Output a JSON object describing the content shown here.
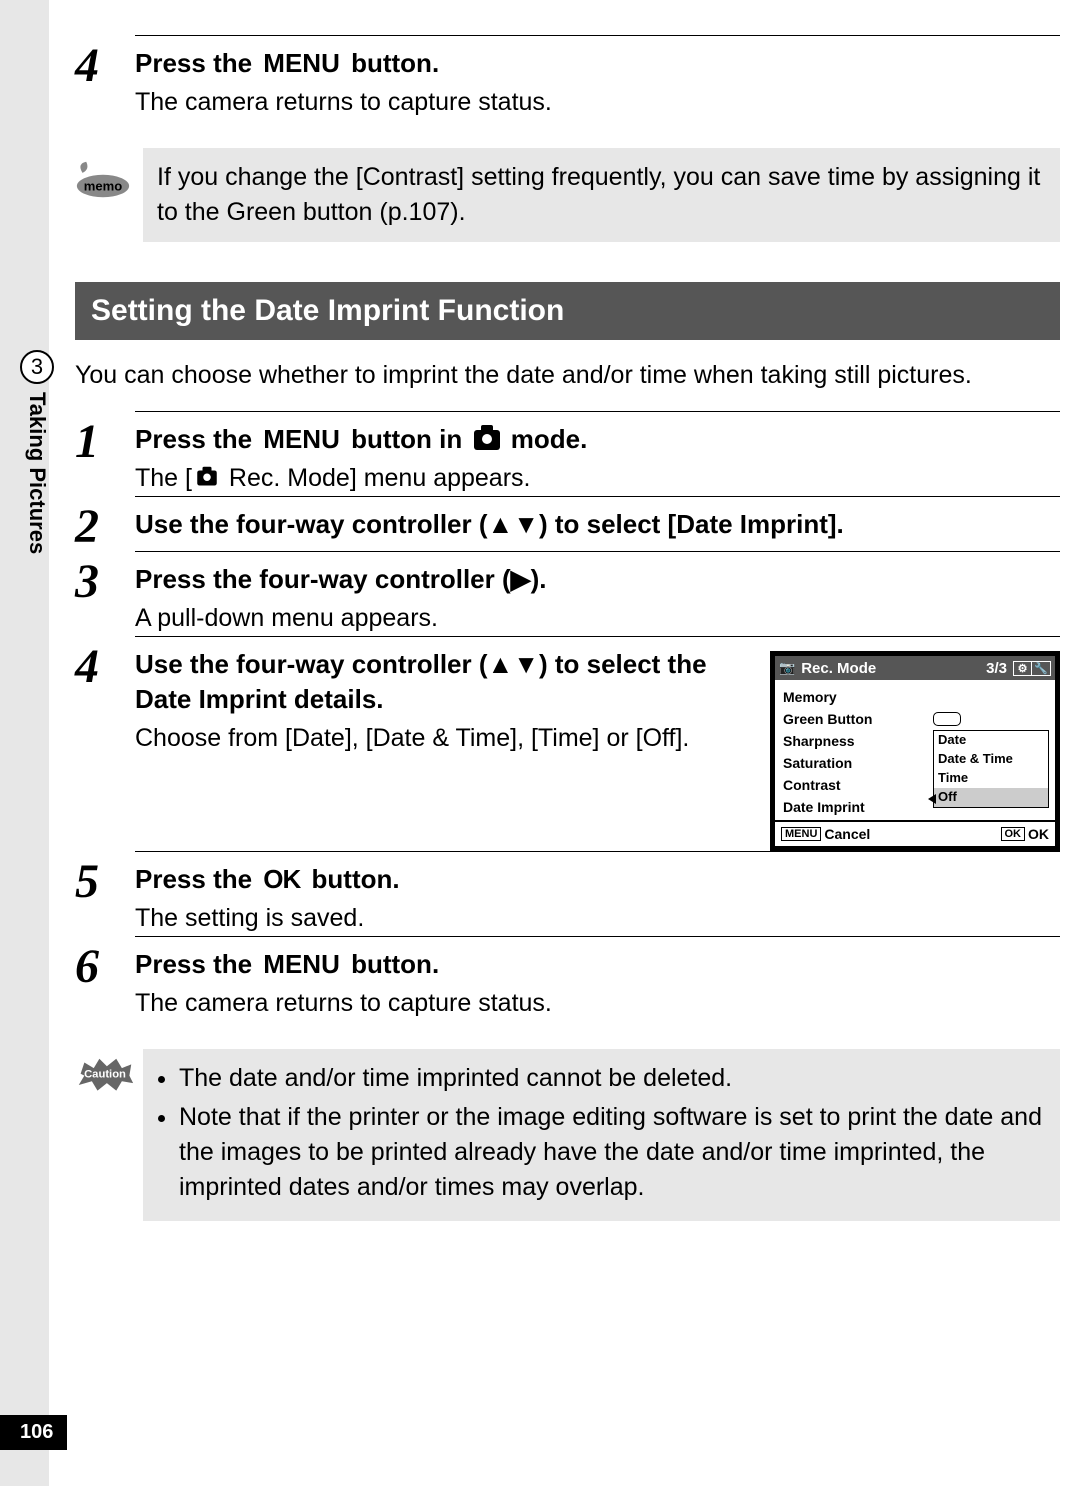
{
  "sideTab": {
    "chapter": "3",
    "label": "Taking Pictures"
  },
  "pageNumber": "106",
  "topStep": {
    "num": "4",
    "title_prefix": "Press the ",
    "title_accent": "MENU",
    "title_suffix": " button.",
    "desc": "The camera returns to capture status."
  },
  "memo": {
    "text": "If you change the [Contrast] setting frequently, you can save time by assigning it to the Green button (p.107)."
  },
  "section": {
    "heading": "Setting the Date Imprint Function",
    "intro": "You can choose whether to imprint the date and/or time when taking still pictures."
  },
  "steps": [
    {
      "num": "1",
      "title_parts": [
        "Press the ",
        "MENU",
        " button in ",
        "CAMICON",
        " mode."
      ],
      "desc_parts": [
        "The [",
        "CAMICON",
        " Rec. Mode] menu appears."
      ]
    },
    {
      "num": "2",
      "title_parts": [
        "Use the four-way controller (▲▼) to select [Date Imprint]."
      ],
      "desc_parts": []
    },
    {
      "num": "3",
      "title_parts": [
        "Press the four-way controller (▶)."
      ],
      "desc_parts": [
        "A pull-down menu appears."
      ]
    },
    {
      "num": "4",
      "title_parts": [
        "Use the four-way controller (▲▼) to select the Date Imprint details."
      ],
      "desc_parts": [
        "Choose from [Date], [Date & Time], [Time] or [Off]."
      ],
      "has_screen": true
    },
    {
      "num": "5",
      "title_parts": [
        "Press the ",
        "OK",
        " button."
      ],
      "desc_parts": [
        "The setting is saved."
      ]
    },
    {
      "num": "6",
      "title_parts": [
        "Press the ",
        "MENU",
        " button."
      ],
      "desc_parts": [
        "The camera returns to capture status."
      ]
    }
  ],
  "cameraScreen": {
    "title": "Rec. Mode",
    "page": "3/3",
    "rows": [
      "Memory",
      "Green Button",
      "Sharpness",
      "Saturation",
      "Contrast",
      "Date Imprint"
    ],
    "dropdown": [
      "Date",
      "Date & Time",
      "Time",
      "Off"
    ],
    "selected": "Off",
    "footer": {
      "leftBox": "MENU",
      "leftLabel": "Cancel",
      "rightBox": "OK",
      "rightLabel": "OK"
    }
  },
  "caution": {
    "lines": [
      "The date and/or time imprinted cannot be deleted.",
      "Note that if the printer or the image editing software is set to print the date and the images to be printed already have the date and/or time imprinted, the imprinted dates and/or times may overlap."
    ]
  }
}
